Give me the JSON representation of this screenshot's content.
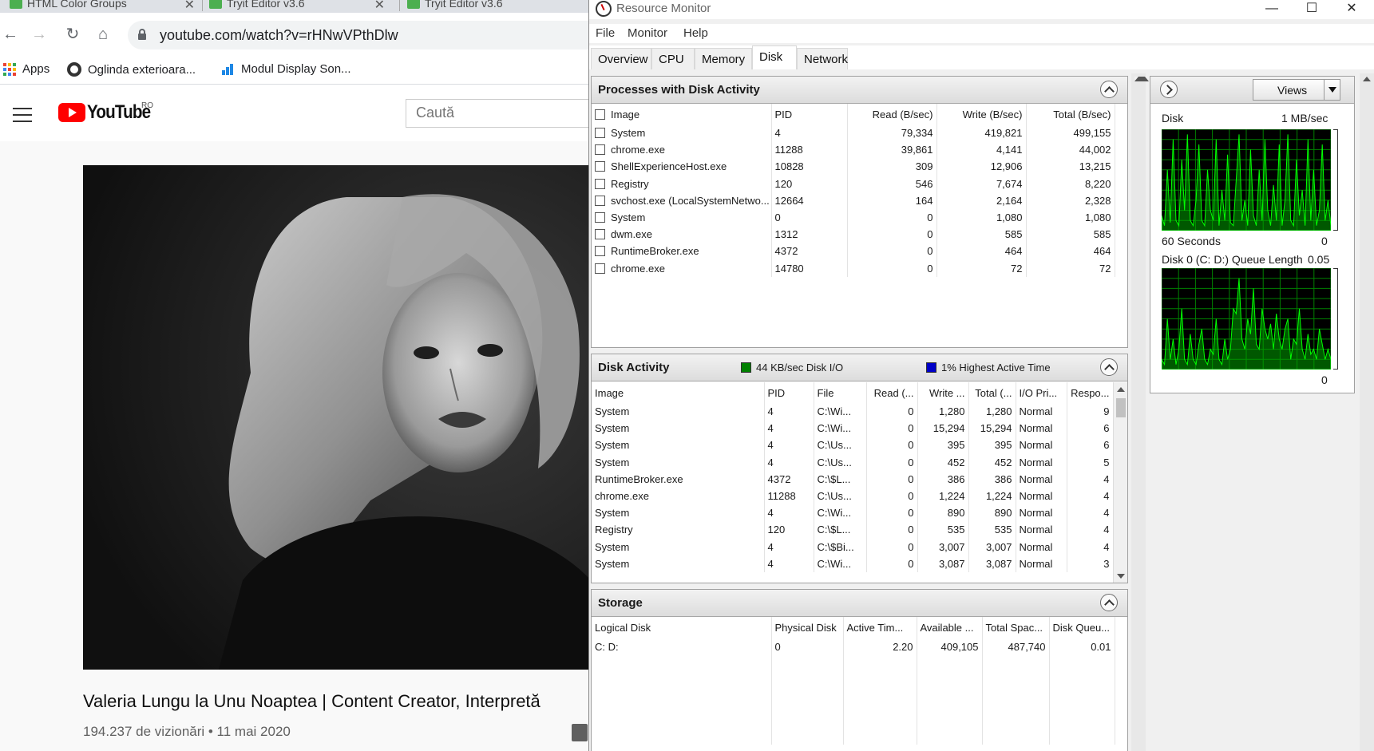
{
  "chrome": {
    "tabs": [
      {
        "label": "HTML Color Groups"
      },
      {
        "label": "Tryit Editor v3.6"
      },
      {
        "label": "Tryit Editor v3.6"
      }
    ],
    "url": "youtube.com/watch?v=rHNwVPthDlw",
    "bookmarks": {
      "apps": "Apps",
      "item1": "Oglinda exterioara...",
      "item2": "Modul Display Son..."
    }
  },
  "youtube": {
    "logo_text": "YouTube",
    "country_code": "RO",
    "search_placeholder": "Caută",
    "video_title": "Valeria Lungu la Unu Noaptea | Content Creator, Interpretă",
    "video_meta": "194.237 de vizionări • 11 mai 2020"
  },
  "resource_monitor": {
    "title": "Resource Monitor",
    "menu": [
      "File",
      "Monitor",
      "Help"
    ],
    "tabs": [
      "Overview",
      "CPU",
      "Memory",
      "Disk",
      "Network"
    ],
    "active_tab": "Disk",
    "processes": {
      "title": "Processes with Disk Activity",
      "columns": [
        "Image",
        "PID",
        "Read (B/sec)",
        "Write (B/sec)",
        "Total (B/sec)"
      ],
      "rows": [
        [
          "System",
          "4",
          "79,334",
          "419,821",
          "499,155"
        ],
        [
          "chrome.exe",
          "11288",
          "39,861",
          "4,141",
          "44,002"
        ],
        [
          "ShellExperienceHost.exe",
          "10828",
          "309",
          "12,906",
          "13,215"
        ],
        [
          "Registry",
          "120",
          "546",
          "7,674",
          "8,220"
        ],
        [
          "svchost.exe (LocalSystemNetwo...",
          "12664",
          "164",
          "2,164",
          "2,328"
        ],
        [
          "System",
          "0",
          "0",
          "1,080",
          "1,080"
        ],
        [
          "dwm.exe",
          "1312",
          "0",
          "585",
          "585"
        ],
        [
          "RuntimeBroker.exe",
          "4372",
          "0",
          "464",
          "464"
        ],
        [
          "chrome.exe",
          "14780",
          "0",
          "72",
          "72"
        ]
      ]
    },
    "disk_activity": {
      "title": "Disk Activity",
      "legend_io": "44 KB/sec Disk I/O",
      "legend_active": "1% Highest Active Time",
      "legend_io_color": "#008000",
      "legend_active_color": "#0000c8",
      "columns": [
        "Image",
        "PID",
        "File",
        "Read (...",
        "Write ...",
        "Total (...",
        "I/O Pri...",
        "Respo..."
      ],
      "rows": [
        [
          "System",
          "4",
          "C:\\Wi...",
          "0",
          "1,280",
          "1,280",
          "Normal",
          "9"
        ],
        [
          "System",
          "4",
          "C:\\Wi...",
          "0",
          "15,294",
          "15,294",
          "Normal",
          "6"
        ],
        [
          "System",
          "4",
          "C:\\Us...",
          "0",
          "395",
          "395",
          "Normal",
          "6"
        ],
        [
          "System",
          "4",
          "C:\\Us...",
          "0",
          "452",
          "452",
          "Normal",
          "5"
        ],
        [
          "RuntimeBroker.exe",
          "4372",
          "C:\\$L...",
          "0",
          "386",
          "386",
          "Normal",
          "4"
        ],
        [
          "chrome.exe",
          "11288",
          "C:\\Us...",
          "0",
          "1,224",
          "1,224",
          "Normal",
          "4"
        ],
        [
          "System",
          "4",
          "C:\\Wi...",
          "0",
          "890",
          "890",
          "Normal",
          "4"
        ],
        [
          "Registry",
          "120",
          "C:\\$L...",
          "0",
          "535",
          "535",
          "Normal",
          "4"
        ],
        [
          "System",
          "4",
          "C:\\$Bi...",
          "0",
          "3,007",
          "3,007",
          "Normal",
          "4"
        ],
        [
          "System",
          "4",
          "C:\\Wi...",
          "0",
          "3,087",
          "3,087",
          "Normal",
          "3"
        ]
      ]
    },
    "storage": {
      "title": "Storage",
      "columns": [
        "Logical Disk",
        "Physical Disk",
        "Active Tim...",
        "Available ...",
        "Total Spac...",
        "Disk Queu..."
      ],
      "rows": [
        [
          "C: D:",
          "0",
          "2.20",
          "409,105",
          "487,740",
          "0.01"
        ]
      ]
    },
    "side": {
      "views_label": "Views",
      "disk_label": "Disk",
      "disk_scale": "1 MB/sec",
      "disk_time": "60 Seconds",
      "disk_min": "0",
      "queue_label": "Disk 0 (C: D:) Queue Length",
      "queue_scale": "0.05",
      "queue_min": "0",
      "disk_series": [
        0.15,
        0.05,
        0.6,
        0.08,
        0.9,
        0.1,
        0.05,
        0.7,
        0.2,
        0.95,
        0.1,
        0.05,
        0.3,
        0.85,
        0.1,
        0.05,
        0.6,
        0.2,
        0.1,
        0.9,
        0.05,
        0.4,
        0.1,
        0.75,
        0.08,
        0.05,
        0.5,
        0.95,
        0.1,
        0.3,
        0.05,
        0.8,
        0.15,
        0.05,
        0.6,
        0.1,
        0.9,
        0.2,
        0.05,
        0.45,
        0.1,
        0.85,
        0.05,
        0.3,
        0.95,
        0.1,
        0.05,
        0.7,
        0.15,
        0.4,
        0.05,
        0.9,
        0.1,
        0.6,
        0.05,
        0.2,
        0.85,
        0.1,
        0.3,
        0.05
      ],
      "queue_series": [
        0.1,
        0.05,
        0.5,
        0.1,
        0.3,
        0.05,
        0.2,
        0.6,
        0.1,
        0.05,
        0.35,
        0.1,
        0.05,
        0.25,
        0.4,
        0.1,
        0.05,
        0.2,
        0.15,
        0.5,
        0.1,
        0.05,
        0.3,
        0.1,
        0.2,
        0.6,
        0.55,
        0.9,
        0.3,
        0.2,
        0.5,
        0.35,
        0.8,
        0.25,
        0.2,
        0.6,
        0.4,
        0.3,
        0.45,
        0.2,
        0.55,
        0.3,
        0.2,
        0.4,
        0.5,
        0.1,
        0.3,
        0.25,
        0.6,
        0.2,
        0.1,
        0.35,
        0.15,
        0.2,
        0.1,
        0.4,
        0.25,
        0.1,
        0.2,
        0.1
      ]
    }
  }
}
